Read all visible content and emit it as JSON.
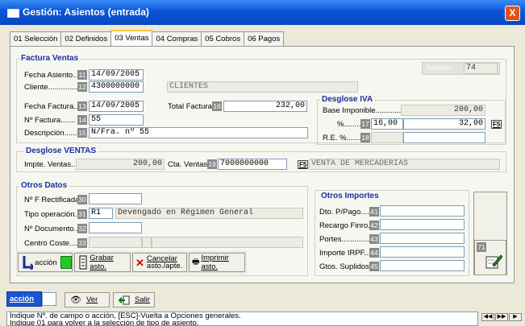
{
  "window": {
    "title": "Gestión: Asientos (entrada)",
    "close": "X"
  },
  "tabs": [
    {
      "label": "01 Selección"
    },
    {
      "label": "02 Definidos"
    },
    {
      "label": "03 Ventas"
    },
    {
      "label": "04 Compras"
    },
    {
      "label": "05 Cobros"
    },
    {
      "label": "06 Pagos"
    }
  ],
  "factura": {
    "title": "Factura Ventas",
    "asiento_label": "Asiento",
    "asiento_value": "74",
    "fecha_asiento_label": "Fecha Asiento...",
    "fecha_asiento_num": "11",
    "fecha_asiento": "14/09/2005",
    "cliente_label": "Cliente..............",
    "cliente_num": "12",
    "cliente": "4300000000",
    "cliente_name": "CLIENTES",
    "fecha_factura_label": "Fecha Factura...",
    "fecha_factura_num": "13",
    "fecha_factura": "14/09/2005",
    "nfactura_label": "Nº Factura.......",
    "nfactura_num": "14",
    "nfactura": "55",
    "descripcion_label": "Descripción.......",
    "descripcion_num": "15",
    "descripcion": "N/Fra. nº 55",
    "total_label": "Total Factura",
    "total_num": "16",
    "total": "232,00"
  },
  "iva": {
    "title": "Desglose IVA",
    "base_label": "Base Imponible...............",
    "base_value": "200,00",
    "pct_label": "%........",
    "pct_num": "17",
    "pct": "16,00",
    "pct_amount": "32,00",
    "f5": "F5",
    "re_label": "R.E. %........",
    "re_num": "18"
  },
  "ventas": {
    "title": "Desglose VENTAS",
    "impte_label": "Impte. Ventas....",
    "impte_value": "200,00",
    "cta_label": "Cta. Ventas",
    "cta_num": "19",
    "cta": "7000000000",
    "f5": "F5",
    "cta_name": "VENTA DE MERCADERIAS"
  },
  "otros": {
    "title": "Otros Datos",
    "nf_label": "Nº F Rectificada",
    "nf_num": "30",
    "tipo_label": "Tipo operación..",
    "tipo_num": "31",
    "tipo_code": "R1",
    "tipo_desc": "Devengado en Régimen General",
    "ndoc_label": "Nº Documento...",
    "ndoc_num": "32",
    "centro_label": "Centro Coste.......",
    "centro_num": "33"
  },
  "importes": {
    "title": "Otros Importes",
    "rows": [
      {
        "label": "Dto. P/Pago....",
        "num": "41"
      },
      {
        "label": "Recargo Finro.",
        "num": "42"
      },
      {
        "label": "Portes.............",
        "num": "43"
      },
      {
        "label": "Importe IRPF....",
        "num": "44"
      },
      {
        "label": "Gtos. Suplidos.",
        "num": "45"
      }
    ],
    "side_num": "71"
  },
  "actions": {
    "accion": "acción",
    "grabar": "Grabar asto.",
    "cancelar_1": "Cancelar",
    "cancelar_2": "asto./apte.",
    "imprimir": "Imprimir asto."
  },
  "bottom": {
    "accion": "acción",
    "ver": "Ver",
    "salir": "Salir"
  },
  "status": {
    "line1": "Indique Nº. de campo o acción, [ESC]-Vuelta a Opciones generales.",
    "line2": "Indique 01 para volver a la selección de tipo de asiento."
  },
  "colors": {
    "title_bar": "#0a55d8",
    "group_title": "#1b2e9a",
    "field_number": "#8a8a8a",
    "accion_green": "#22cc22"
  }
}
